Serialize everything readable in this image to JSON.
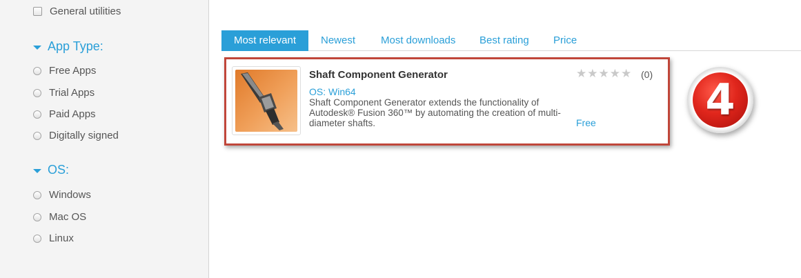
{
  "sidebar": {
    "top_filter": {
      "label": "General utilities"
    },
    "app_type": {
      "heading": "App Type:",
      "options": [
        "Free Apps",
        "Trial Apps",
        "Paid Apps",
        "Digitally signed"
      ]
    },
    "os": {
      "heading": "OS:",
      "options": [
        "Windows",
        "Mac OS",
        "Linux"
      ]
    }
  },
  "tabs": [
    {
      "label": "Most relevant",
      "active": true
    },
    {
      "label": "Newest"
    },
    {
      "label": "Most downloads"
    },
    {
      "label": "Best rating"
    },
    {
      "label": "Price"
    }
  ],
  "result": {
    "title": "Shaft Component Generator",
    "os": "OS: Win64",
    "description": "Shaft Component Generator extends the functionality of Autodesk® Fusion 360™ by automating the creation of multi-diameter shafts.",
    "rating_stars": 0,
    "rating_count": "(0)",
    "price": "Free"
  },
  "step_badge": {
    "number": "4"
  },
  "colors": {
    "accent": "#2a9fd8",
    "highlight_border": "#c0463a",
    "badge_red": "#e0261c"
  }
}
